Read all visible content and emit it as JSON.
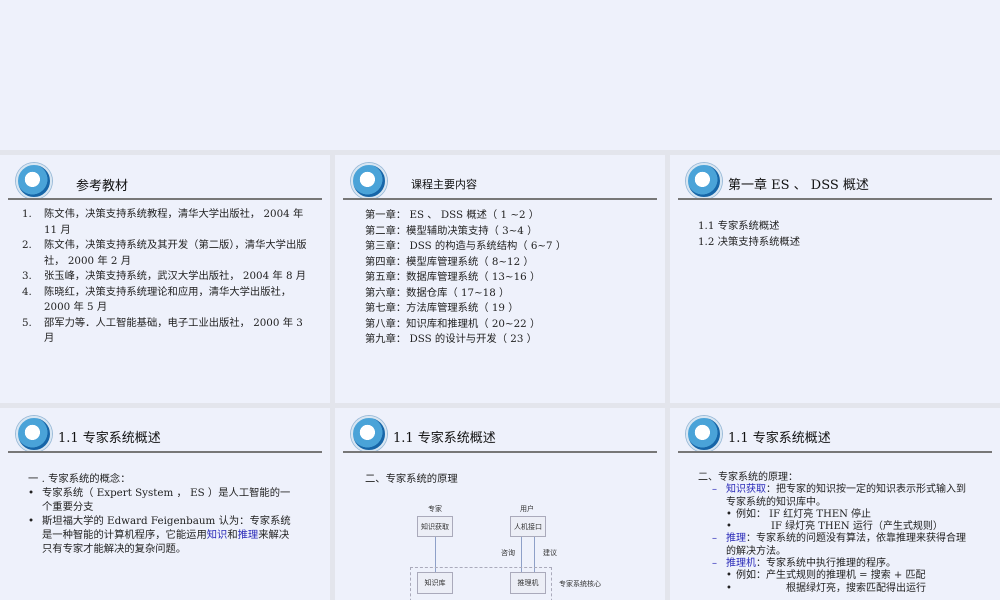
{
  "slides": [
    {
      "title": "参考教材",
      "refs": [
        {
          "n": "1.",
          "text": "陈文伟，决策支持系统教程，清华大学出版社， 2004 年 11 月"
        },
        {
          "n": "2.",
          "text": "陈文伟，决策支持系统及其开发（第二版），清华大学出版社， 2000 年 2 月"
        },
        {
          "n": "3.",
          "text": "张玉峰，决策支持系统，武汉大学出版社，  2004 年 8 月"
        },
        {
          "n": "4.",
          "text": "陈晓红，决策支持系统理论和应用，清华大学出版社， 2000 年 5 月"
        },
        {
          "n": "5.",
          "text": "邵军力等．人工智能基础，电子工业出版社，  2000 年 3 月"
        }
      ]
    },
    {
      "title": "课程主要内容",
      "chapters": [
        "第一章： ES 、 DSS 概述（  1 ~2 ）",
        "第二章：模型辅助决策支持（ 3~4 ）",
        "第三章： DSS 的构造与系统结构（ 6~7 ）",
        "第四章：模型库管理系统（ 8~12 ）",
        "第五章：数据库管理系统（ 13~16 ）",
        "第六章：数据仓库（ 17~18 ）",
        "第七章：方法库管理系统（ 19 ）",
        "第八章：知识库和推理机（ 20~22 ）",
        "第九章： DSS 的设计与开发（ 23 ）"
      ]
    },
    {
      "title": "第一章  ES 、 DSS 概述",
      "items": [
        "1.1  专家系统概述",
        "1.2  决策支持系统概述"
      ]
    },
    {
      "title": "1.1  专家系统概述",
      "heading": "一 . 专家系统的概念：",
      "b1": "专家系统（ Expert System ， ES ）是人工智能的一个重要分支",
      "b2a": "斯坦福大学的 Edward Feigenbaum 认为：专家系统是一种智能的计算机程序，它能运用",
      "b2k": "知识",
      "b2h": "和",
      "b2r": "推理",
      "b2b": "来解决只有专家才能解决的复杂问题。",
      "bullet": "•"
    },
    {
      "title": "1.1  专家系统概述",
      "heading": "二、专家系统的原理",
      "diagram": {
        "expert": "专家",
        "user": "用户",
        "acquire": "知识获取",
        "hci": "人机接口",
        "consult": "咨询",
        "advice": "建议",
        "kb": "知识库",
        "engine": "推理机",
        "core": "专家系统核心"
      }
    },
    {
      "title": "1.1  专家系统概述",
      "heading": "二、专家系统的原理：",
      "dash": "–",
      "bullet": "•",
      "p1k": "知识获取",
      "p1": "：把专家的知识按一定的知识表示形式输入到专家系统的知识库中。",
      "e1": "例如：  IF  红灯亮   THEN  停止",
      "e2": "IF  绿灯亮   THEN  运行（产生式规则）",
      "p2k": "推理",
      "p2": "：专家系统的问题没有算法，依靠推理来获得合理的解决方法。",
      "p3k": "推理机",
      "p3": "：专家系统中执行推理的程序。",
      "e3": "例如：产生式规则的推理机 = 搜索 + 匹配",
      "e4": "根据绿灯亮，搜索匹配得出运行"
    }
  ]
}
